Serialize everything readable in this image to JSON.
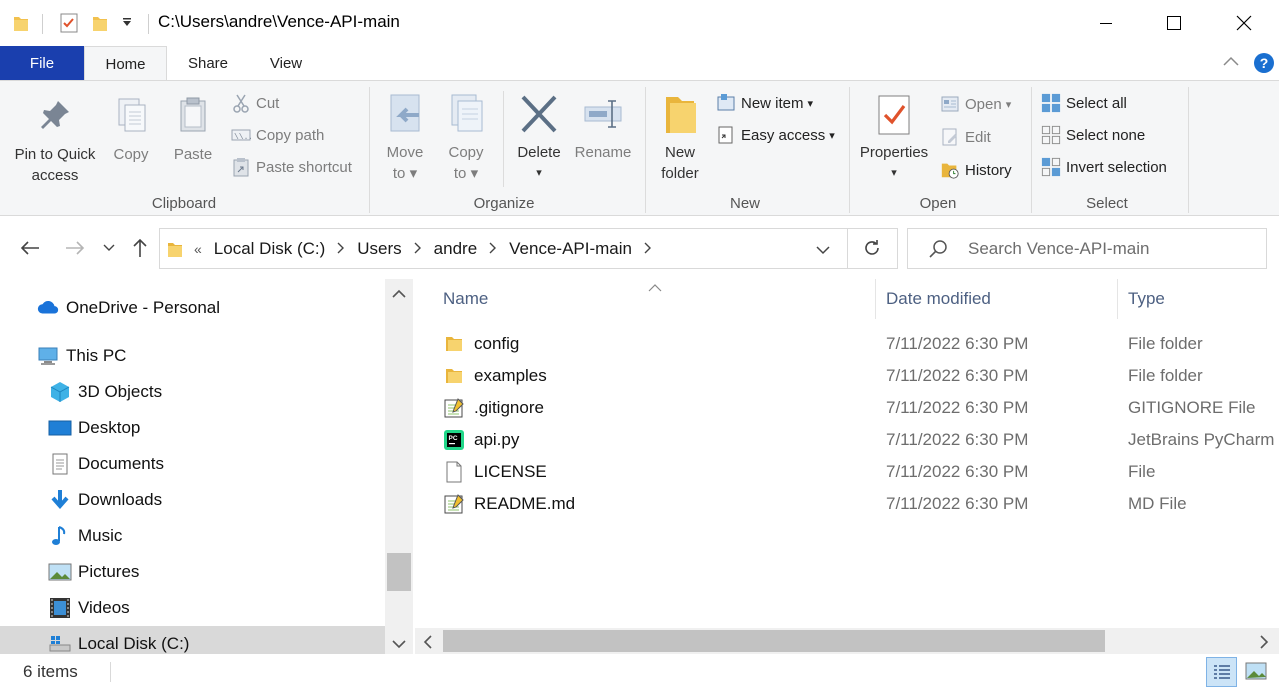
{
  "window": {
    "title": "C:\\Users\\andre\\Vence-API-main"
  },
  "tabs": {
    "file": "File",
    "home": "Home",
    "share": "Share",
    "view": "View"
  },
  "ribbon": {
    "clipboard": {
      "label": "Clipboard",
      "pin": "Pin to Quick access",
      "pin_line1": "Pin to Quick",
      "pin_line2": "access",
      "copy": "Copy",
      "paste": "Paste",
      "cut": "Cut",
      "copy_path": "Copy path",
      "paste_shortcut": "Paste shortcut"
    },
    "organize": {
      "label": "Organize",
      "move_line1": "Move",
      "move_line2": "to",
      "copy_line1": "Copy",
      "copy_line2": "to",
      "delete": "Delete",
      "rename": "Rename"
    },
    "new": {
      "label": "New",
      "new_folder_line1": "New",
      "new_folder_line2": "folder",
      "new_item": "New item",
      "easy_access": "Easy access"
    },
    "open": {
      "label": "Open",
      "properties": "Properties",
      "open": "Open",
      "edit": "Edit",
      "history": "History"
    },
    "select": {
      "label": "Select",
      "select_all": "Select all",
      "select_none": "Select none",
      "invert_selection": "Invert selection"
    }
  },
  "address": {
    "prefix": "«",
    "crumbs": [
      "Local Disk (C:)",
      "Users",
      "andre",
      "Vence-API-main"
    ]
  },
  "search": {
    "placeholder": "Search Vence-API-main"
  },
  "navpane": {
    "items": [
      {
        "label": "OneDrive - Personal",
        "icon": "onedrive-icon"
      },
      {
        "label": "This PC",
        "icon": "this-pc-icon"
      },
      {
        "label": "3D Objects",
        "icon": "3d-objects-icon"
      },
      {
        "label": "Desktop",
        "icon": "desktop-icon"
      },
      {
        "label": "Documents",
        "icon": "documents-icon"
      },
      {
        "label": "Downloads",
        "icon": "downloads-icon"
      },
      {
        "label": "Music",
        "icon": "music-icon"
      },
      {
        "label": "Pictures",
        "icon": "pictures-icon"
      },
      {
        "label": "Videos",
        "icon": "videos-icon"
      },
      {
        "label": "Local Disk (C:)",
        "icon": "local-disk-icon"
      }
    ]
  },
  "filelist": {
    "columns": [
      "Name",
      "Date modified",
      "Type"
    ],
    "rows": [
      {
        "name": "config",
        "date": "7/11/2022 6:30 PM",
        "type": "File folder",
        "icon": "folder-icon"
      },
      {
        "name": "examples",
        "date": "7/11/2022 6:30 PM",
        "type": "File folder",
        "icon": "folder-icon"
      },
      {
        "name": ".gitignore",
        "date": "7/11/2022 6:30 PM",
        "type": "GITIGNORE File",
        "icon": "notepad-file-icon"
      },
      {
        "name": "api.py",
        "date": "7/11/2022 6:30 PM",
        "type": "JetBrains PyCharm",
        "icon": "pycharm-file-icon"
      },
      {
        "name": "LICENSE",
        "date": "7/11/2022 6:30 PM",
        "type": "File",
        "icon": "blank-file-icon"
      },
      {
        "name": "README.md",
        "date": "7/11/2022 6:30 PM",
        "type": "MD File",
        "icon": "notepad-file-icon"
      }
    ]
  },
  "status": {
    "count": "6 items"
  },
  "colors": {
    "file_tab": "#1a3fae",
    "accent": "#0078d7",
    "folder": "#f2c14e",
    "selected": "#d9d9d9"
  }
}
